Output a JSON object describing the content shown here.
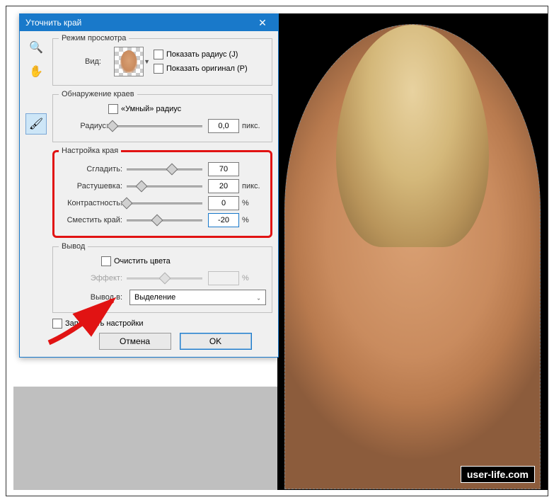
{
  "dialog": {
    "title": "Уточнить край",
    "close_icon": "✕",
    "tools": {
      "zoom": "🔍",
      "hand": "✋",
      "brush": "🖌"
    },
    "view_section": {
      "legend": "Режим просмотра",
      "view_label": "Вид:",
      "show_radius": "Показать радиус (J)",
      "show_original": "Показать оригинал (P)"
    },
    "edge_section": {
      "legend": "Обнаружение краев",
      "smart_radius": "«Умный» радиус",
      "radius_label": "Радиус:",
      "radius_value": "0,0",
      "radius_unit": "пикс."
    },
    "adjust_section": {
      "legend": "Настройка края",
      "smooth_label": "Сгладить:",
      "smooth_value": "70",
      "feather_label": "Растушевка:",
      "feather_value": "20",
      "feather_unit": "пикс.",
      "contrast_label": "Контрастность:",
      "contrast_value": "0",
      "contrast_unit": "%",
      "shift_label": "Сместить край:",
      "shift_value": "-20",
      "shift_unit": "%"
    },
    "output_section": {
      "legend": "Вывод",
      "cleanup": "Очистить цвета",
      "effect_label": "Эффект:",
      "effect_unit": "%",
      "output_to_label": "Вывод в:",
      "output_to_value": "Выделение"
    },
    "remember": "Запомнить настройки",
    "cancel": "Отмена",
    "ok": "OK"
  },
  "watermark": "user-life.com"
}
